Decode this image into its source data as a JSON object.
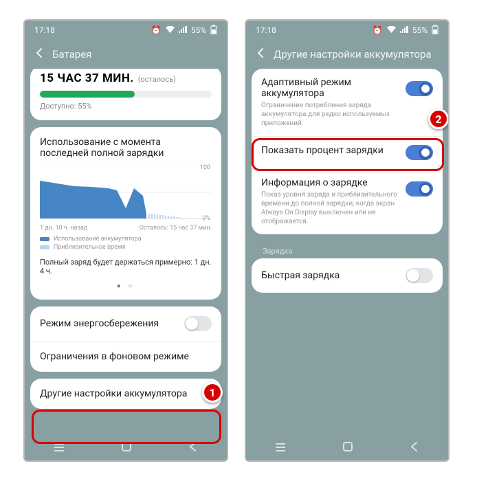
{
  "status": {
    "time": "17:18",
    "battery": "55%"
  },
  "left": {
    "header": "Батарея",
    "readout": "15 ЧАС 37 МИН.",
    "remaining_suffix": "(осталось)",
    "available": "Доступно: 55%",
    "usage_title": "Использование с момента последней полной зарядки",
    "x_left": "1 дн. 10 ч. назад",
    "x_right": "Осталось: 15 час 37 мин.",
    "legend_use": "Использование аккумулятора",
    "legend_est": "Приблизительное время",
    "estimate": "Полный заряд будет держаться примерно: 1 дн. 4 ч.",
    "row_power": "Режим энергосбережения",
    "row_bg": "Ограничения в фоновом режиме",
    "row_other": "Другие настройки аккумулятора"
  },
  "right": {
    "header": "Другие настройки аккумулятора",
    "adaptive_title": "Адаптивный режим аккумулятора",
    "adaptive_desc": "Ограничение потребления заряда аккумулятора для редко используемых приложений.",
    "percent_title": "Показать процент зарядки",
    "info_title": "Информация о зарядке",
    "info_desc": "Показ уровня заряда и приблизительного времени до полной зарядки, когда экран Always On Display выключен или не отображается.",
    "section": "Зарядка",
    "fast_title": "Быстрая зарядка"
  },
  "colors": {
    "accent": "#4a7ed4",
    "chart": "#4686c5"
  },
  "chart_data": {
    "type": "area",
    "title": "Использование с момента последней полной зарядки",
    "xlabel": "",
    "ylabel": "",
    "ylim": [
      0,
      100
    ],
    "x_range_labels": [
      "1 дн. 10 ч. назад",
      "Осталось: 15 час 37 мин."
    ],
    "series": [
      {
        "name": "Использование аккумулятора",
        "x": [
          0,
          10,
          20,
          30,
          40,
          45,
          50,
          55,
          60,
          62
        ],
        "values": [
          70,
          65,
          60,
          58,
          55,
          50,
          20,
          55,
          40,
          10
        ]
      },
      {
        "name": "Приблизительное время",
        "x": [
          62,
          100
        ],
        "values": [
          10,
          0
        ]
      }
    ]
  }
}
